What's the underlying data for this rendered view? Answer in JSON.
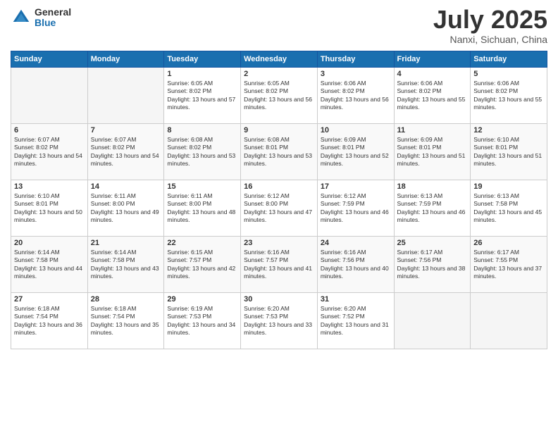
{
  "logo": {
    "general": "General",
    "blue": "Blue"
  },
  "title": "July 2025",
  "location": "Nanxi, Sichuan, China",
  "days_of_week": [
    "Sunday",
    "Monday",
    "Tuesday",
    "Wednesday",
    "Thursday",
    "Friday",
    "Saturday"
  ],
  "weeks": [
    [
      {
        "day": "",
        "info": ""
      },
      {
        "day": "",
        "info": ""
      },
      {
        "day": "1",
        "info": "Sunrise: 6:05 AM\nSunset: 8:02 PM\nDaylight: 13 hours and 57 minutes."
      },
      {
        "day": "2",
        "info": "Sunrise: 6:05 AM\nSunset: 8:02 PM\nDaylight: 13 hours and 56 minutes."
      },
      {
        "day": "3",
        "info": "Sunrise: 6:06 AM\nSunset: 8:02 PM\nDaylight: 13 hours and 56 minutes."
      },
      {
        "day": "4",
        "info": "Sunrise: 6:06 AM\nSunset: 8:02 PM\nDaylight: 13 hours and 55 minutes."
      },
      {
        "day": "5",
        "info": "Sunrise: 6:06 AM\nSunset: 8:02 PM\nDaylight: 13 hours and 55 minutes."
      }
    ],
    [
      {
        "day": "6",
        "info": "Sunrise: 6:07 AM\nSunset: 8:02 PM\nDaylight: 13 hours and 54 minutes."
      },
      {
        "day": "7",
        "info": "Sunrise: 6:07 AM\nSunset: 8:02 PM\nDaylight: 13 hours and 54 minutes."
      },
      {
        "day": "8",
        "info": "Sunrise: 6:08 AM\nSunset: 8:02 PM\nDaylight: 13 hours and 53 minutes."
      },
      {
        "day": "9",
        "info": "Sunrise: 6:08 AM\nSunset: 8:01 PM\nDaylight: 13 hours and 53 minutes."
      },
      {
        "day": "10",
        "info": "Sunrise: 6:09 AM\nSunset: 8:01 PM\nDaylight: 13 hours and 52 minutes."
      },
      {
        "day": "11",
        "info": "Sunrise: 6:09 AM\nSunset: 8:01 PM\nDaylight: 13 hours and 51 minutes."
      },
      {
        "day": "12",
        "info": "Sunrise: 6:10 AM\nSunset: 8:01 PM\nDaylight: 13 hours and 51 minutes."
      }
    ],
    [
      {
        "day": "13",
        "info": "Sunrise: 6:10 AM\nSunset: 8:01 PM\nDaylight: 13 hours and 50 minutes."
      },
      {
        "day": "14",
        "info": "Sunrise: 6:11 AM\nSunset: 8:00 PM\nDaylight: 13 hours and 49 minutes."
      },
      {
        "day": "15",
        "info": "Sunrise: 6:11 AM\nSunset: 8:00 PM\nDaylight: 13 hours and 48 minutes."
      },
      {
        "day": "16",
        "info": "Sunrise: 6:12 AM\nSunset: 8:00 PM\nDaylight: 13 hours and 47 minutes."
      },
      {
        "day": "17",
        "info": "Sunrise: 6:12 AM\nSunset: 7:59 PM\nDaylight: 13 hours and 46 minutes."
      },
      {
        "day": "18",
        "info": "Sunrise: 6:13 AM\nSunset: 7:59 PM\nDaylight: 13 hours and 46 minutes."
      },
      {
        "day": "19",
        "info": "Sunrise: 6:13 AM\nSunset: 7:58 PM\nDaylight: 13 hours and 45 minutes."
      }
    ],
    [
      {
        "day": "20",
        "info": "Sunrise: 6:14 AM\nSunset: 7:58 PM\nDaylight: 13 hours and 44 minutes."
      },
      {
        "day": "21",
        "info": "Sunrise: 6:14 AM\nSunset: 7:58 PM\nDaylight: 13 hours and 43 minutes."
      },
      {
        "day": "22",
        "info": "Sunrise: 6:15 AM\nSunset: 7:57 PM\nDaylight: 13 hours and 42 minutes."
      },
      {
        "day": "23",
        "info": "Sunrise: 6:16 AM\nSunset: 7:57 PM\nDaylight: 13 hours and 41 minutes."
      },
      {
        "day": "24",
        "info": "Sunrise: 6:16 AM\nSunset: 7:56 PM\nDaylight: 13 hours and 40 minutes."
      },
      {
        "day": "25",
        "info": "Sunrise: 6:17 AM\nSunset: 7:56 PM\nDaylight: 13 hours and 38 minutes."
      },
      {
        "day": "26",
        "info": "Sunrise: 6:17 AM\nSunset: 7:55 PM\nDaylight: 13 hours and 37 minutes."
      }
    ],
    [
      {
        "day": "27",
        "info": "Sunrise: 6:18 AM\nSunset: 7:54 PM\nDaylight: 13 hours and 36 minutes."
      },
      {
        "day": "28",
        "info": "Sunrise: 6:18 AM\nSunset: 7:54 PM\nDaylight: 13 hours and 35 minutes."
      },
      {
        "day": "29",
        "info": "Sunrise: 6:19 AM\nSunset: 7:53 PM\nDaylight: 13 hours and 34 minutes."
      },
      {
        "day": "30",
        "info": "Sunrise: 6:20 AM\nSunset: 7:53 PM\nDaylight: 13 hours and 33 minutes."
      },
      {
        "day": "31",
        "info": "Sunrise: 6:20 AM\nSunset: 7:52 PM\nDaylight: 13 hours and 31 minutes."
      },
      {
        "day": "",
        "info": ""
      },
      {
        "day": "",
        "info": ""
      }
    ]
  ]
}
